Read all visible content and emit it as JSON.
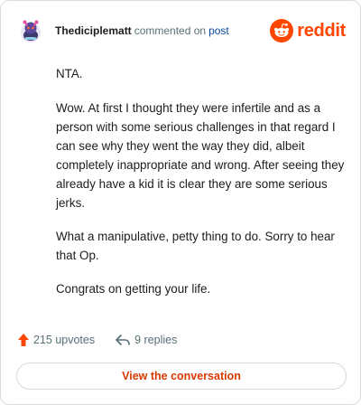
{
  "header": {
    "username": "Thediciplematt",
    "action_text": "commented on",
    "post_link": "post",
    "brand_name": "reddit",
    "avatar_icon": "snoo-avatar-icon",
    "brand_icon": "reddit-logo-icon"
  },
  "comment": {
    "paragraphs": [
      "NTA.",
      "Wow. At first I thought they were infertile and as a person with some serious challenges in that regard I can see why they went the way they did, albeit completely inappropriate and wrong. After seeing they already have a kid it is clear they are some serious jerks.",
      "What a manipulative, petty thing to do. Sorry to hear that Op.",
      "Congrats on getting your life."
    ]
  },
  "footer": {
    "upvotes": "215 upvotes",
    "replies": "9 replies",
    "upvote_icon": "upvote-arrow-icon",
    "reply_icon": "reply-arrow-icon"
  },
  "cta": {
    "label": "View the conversation"
  },
  "colors": {
    "brand": "#ff4500",
    "link": "#0a4a9f",
    "cta_text": "#d93900",
    "muted": "#576f76"
  }
}
